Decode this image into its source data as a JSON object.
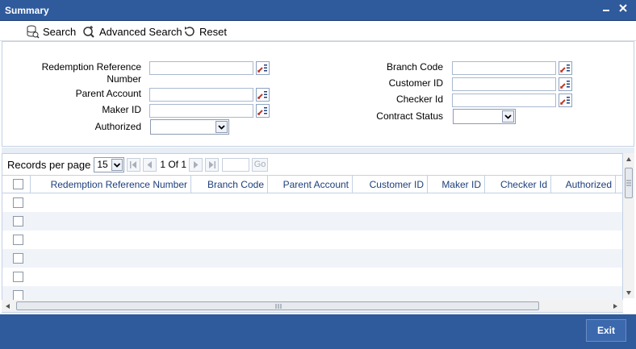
{
  "window": {
    "title": "Summary",
    "minimize_icon": "minimize-icon",
    "close_icon": "close-icon"
  },
  "toolbar": {
    "search": "Search",
    "advanced_search": "Advanced Search",
    "reset": "Reset"
  },
  "form": {
    "redemption_ref_label": "Redemption Reference Number",
    "parent_account_label": "Parent Account",
    "maker_id_label": "Maker ID",
    "authorized_label": "Authorized",
    "branch_code_label": "Branch Code",
    "customer_id_label": "Customer ID",
    "checker_id_label": "Checker Id",
    "contract_status_label": "Contract Status"
  },
  "pager": {
    "records_per_page_label": "Records per page",
    "records_per_page": "15",
    "page_info": "1 Of 1",
    "go": "Go"
  },
  "columns": [
    "Redemption Reference Number",
    "Branch Code",
    "Parent Account",
    "Customer ID",
    "Maker ID",
    "Checker Id",
    "Authorized"
  ],
  "footer": {
    "exit": "Exit"
  }
}
